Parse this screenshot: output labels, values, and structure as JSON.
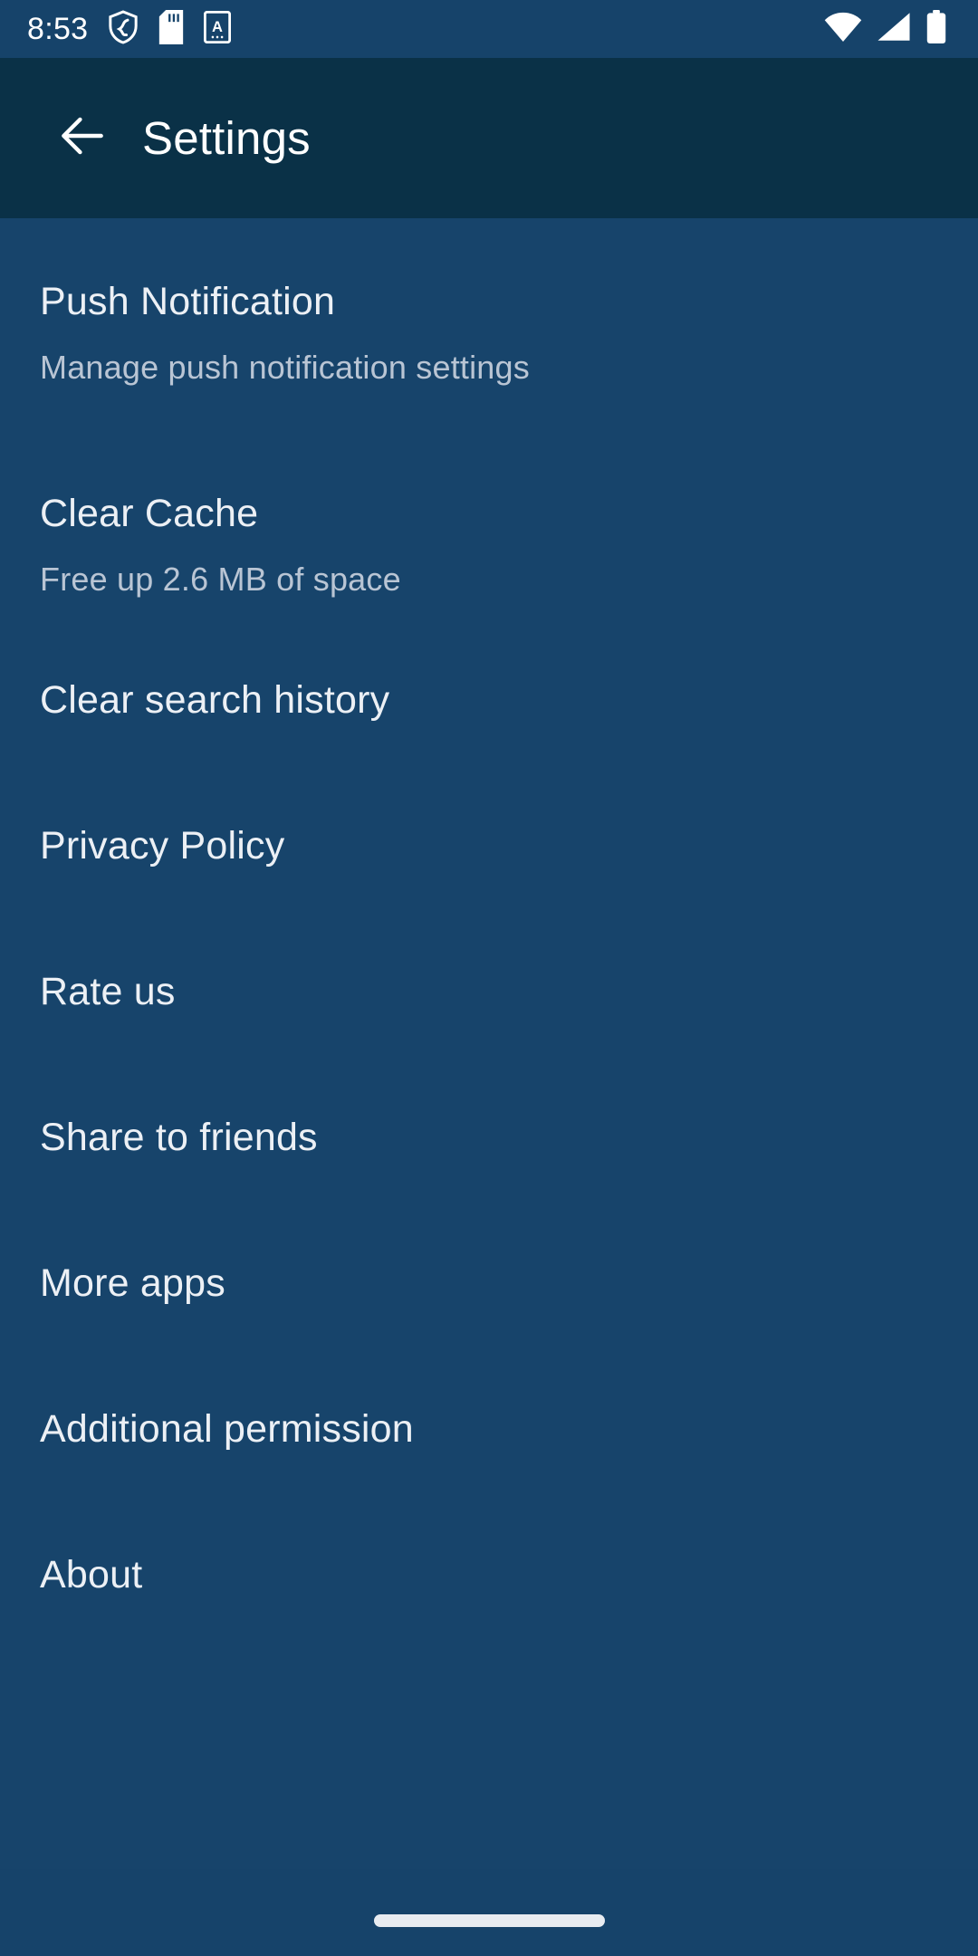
{
  "status_bar": {
    "time": "8:53",
    "left_icons": [
      {
        "name": "shield-privacy-icon"
      },
      {
        "name": "sd-card-icon"
      },
      {
        "name": "keyboard-language-a-icon",
        "glyph": "A"
      }
    ],
    "right_icons": [
      {
        "name": "wifi-icon"
      },
      {
        "name": "cellular-signal-icon"
      },
      {
        "name": "battery-icon"
      }
    ]
  },
  "app_bar": {
    "back_label": "Back",
    "title": "Settings"
  },
  "settings": {
    "items": [
      {
        "title": "Push Notification",
        "subtitle": "Manage push notification settings"
      },
      {
        "title": "Clear Cache",
        "subtitle": "Free up 2.6 MB of space"
      },
      {
        "title": "Clear search history",
        "subtitle": ""
      },
      {
        "title": "Privacy Policy",
        "subtitle": ""
      },
      {
        "title": "Rate us",
        "subtitle": ""
      },
      {
        "title": "Share to friends",
        "subtitle": ""
      },
      {
        "title": "More apps",
        "subtitle": ""
      },
      {
        "title": "Additional permission",
        "subtitle": ""
      },
      {
        "title": "About",
        "subtitle": ""
      }
    ]
  },
  "nav_bar": {
    "gesture_handle": "home-gesture-pill"
  },
  "colors": {
    "status_bar_bg": "#16436a",
    "app_bar_bg": "#0a3147",
    "page_bg": "#17446b",
    "primary_text": "#ecf0f5",
    "secondary_text": "#b9c5d4",
    "icon_white": "#ffffff"
  }
}
